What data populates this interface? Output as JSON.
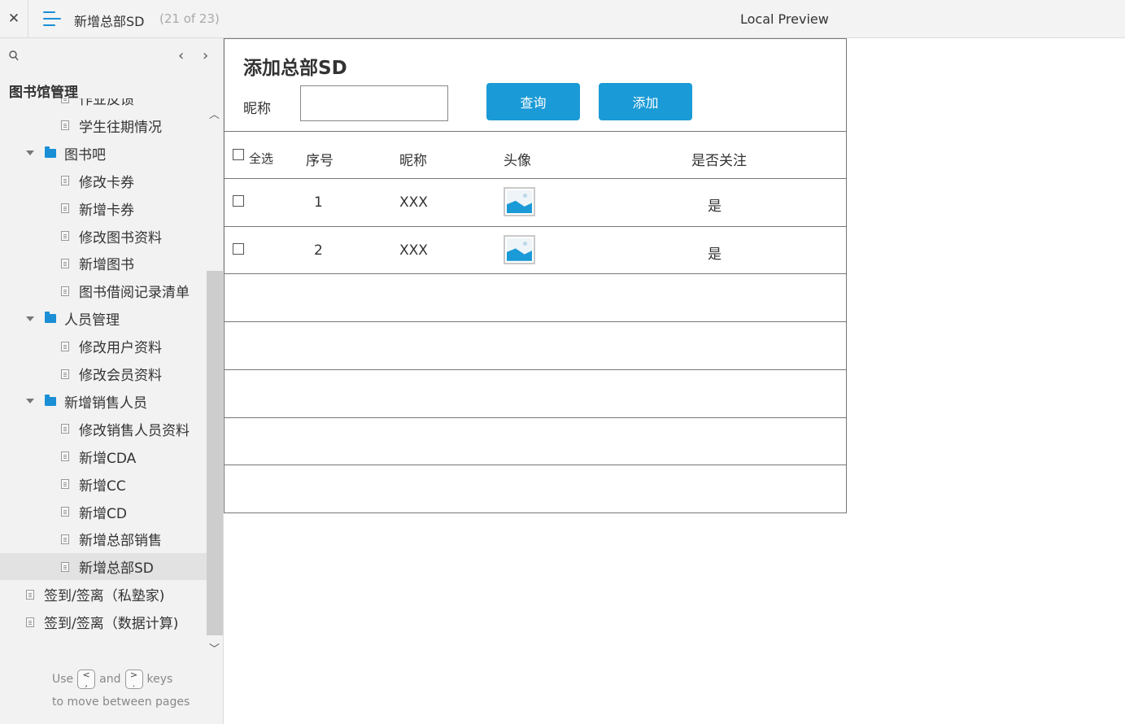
{
  "topbar": {
    "close_glyph": "✕",
    "page_title": "新增总部SD",
    "page_count": "(21 of 23)",
    "preview_label": "Local Preview"
  },
  "sidebar": {
    "root_label": "图书馆管理",
    "items": [
      {
        "label": "作业反馈",
        "kind": "page"
      },
      {
        "label": "学生往期情况",
        "kind": "page"
      },
      {
        "label": "图书吧",
        "kind": "folder"
      },
      {
        "label": "修改卡券",
        "kind": "page"
      },
      {
        "label": "新增卡券",
        "kind": "page"
      },
      {
        "label": "修改图书资料",
        "kind": "page"
      },
      {
        "label": "新增图书",
        "kind": "page"
      },
      {
        "label": "图书借阅记录清单",
        "kind": "page"
      },
      {
        "label": "人员管理",
        "kind": "folder"
      },
      {
        "label": "修改用户资料",
        "kind": "page"
      },
      {
        "label": "修改会员资料",
        "kind": "page"
      },
      {
        "label": "新增销售人员",
        "kind": "folder"
      },
      {
        "label": "修改销售人员资料",
        "kind": "page"
      },
      {
        "label": "新增CDA",
        "kind": "page"
      },
      {
        "label": "新增CC",
        "kind": "page"
      },
      {
        "label": "新增CD",
        "kind": "page"
      },
      {
        "label": "新增总部销售",
        "kind": "page"
      },
      {
        "label": "新增总部SD",
        "kind": "page",
        "selected": true
      },
      {
        "label": "签到/签离（私塾家)",
        "kind": "page"
      },
      {
        "label": "签到/签离（数据计算)",
        "kind": "page"
      }
    ],
    "hint": {
      "use": "Use",
      "key_prev": "<\n,",
      "and": "and",
      "key_next": ">\n.",
      "keys": "keys",
      "line2": "to move between pages"
    }
  },
  "form": {
    "title": "添加总部SD",
    "nick_label": "昵称",
    "nick_value": "",
    "query_label": "查询",
    "add_label": "添加"
  },
  "table": {
    "headers": {
      "select_all": "全选",
      "index": "序号",
      "nickname": "昵称",
      "avatar": "头像",
      "followed": "是否关注"
    },
    "rows": [
      {
        "index": "1",
        "nickname": "XXX",
        "followed": "是"
      },
      {
        "index": "2",
        "nickname": "XXX",
        "followed": "是"
      }
    ],
    "empty_rows": 5
  },
  "colors": {
    "accent": "#1a9ad6",
    "sidebar_bg": "#f2f2f2"
  }
}
